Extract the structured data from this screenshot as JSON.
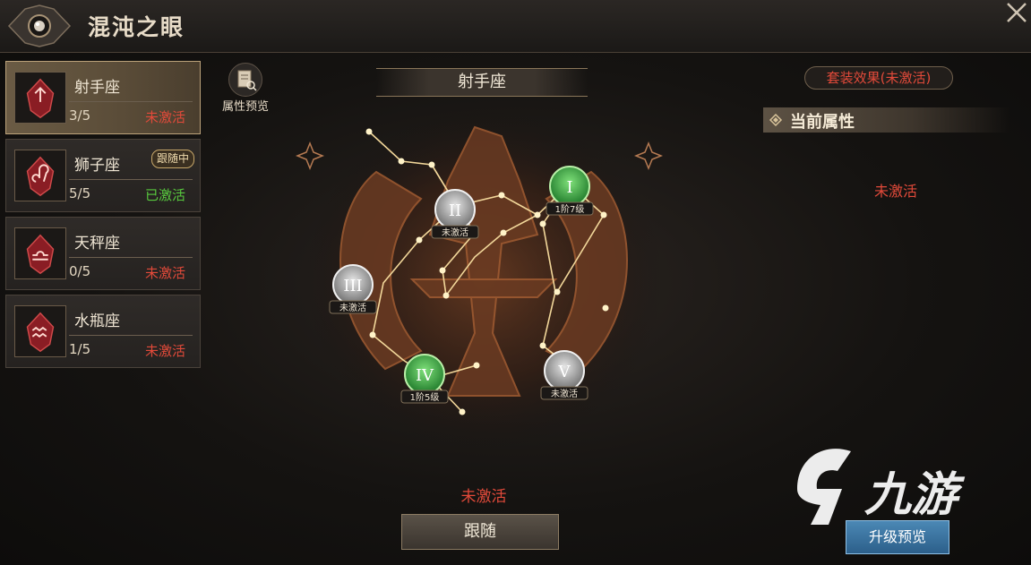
{
  "header": {
    "title": "混沌之眼"
  },
  "sidebar": {
    "items": [
      {
        "name": "射手座",
        "progress": "3/5",
        "status": "未激活",
        "status_color": "#e24a3a",
        "selected": true,
        "icon": "sagittarius-glyph"
      },
      {
        "name": "狮子座",
        "progress": "5/5",
        "status": "已激活",
        "status_color": "#58c93e",
        "tag": "跟随中",
        "icon": "leo-glyph"
      },
      {
        "name": "天秤座",
        "progress": "0/5",
        "status": "未激活",
        "status_color": "#e24a3a",
        "icon": "libra-glyph"
      },
      {
        "name": "水瓶座",
        "progress": "1/5",
        "status": "未激活",
        "status_color": "#e24a3a",
        "icon": "aquarius-glyph"
      }
    ]
  },
  "attr_preview": {
    "label": "属性预览",
    "icon": "scroll-search-icon"
  },
  "constellation": {
    "title": "射手座",
    "nodes": [
      {
        "numeral": "I",
        "label": "1阶7级",
        "active": true
      },
      {
        "numeral": "II",
        "label": "未激活",
        "active": false
      },
      {
        "numeral": "III",
        "label": "未激活",
        "active": false
      },
      {
        "numeral": "IV",
        "label": "1阶5级",
        "active": true
      },
      {
        "numeral": "V",
        "label": "未激活",
        "active": false
      }
    ],
    "status": "未激活",
    "follow_button": "跟随"
  },
  "right_panel": {
    "set_effect": "套装效果(未激活)",
    "current_attr_title": "当前属性",
    "current_attr_status": "未激活",
    "upgrade_button": "升级预览"
  },
  "watermark": {
    "text": "九游"
  },
  "colors": {
    "inactive": "#e24a3a",
    "active": "#58c93e",
    "accent_blue": "#2c5f8a",
    "gold": "#c8a86a"
  }
}
